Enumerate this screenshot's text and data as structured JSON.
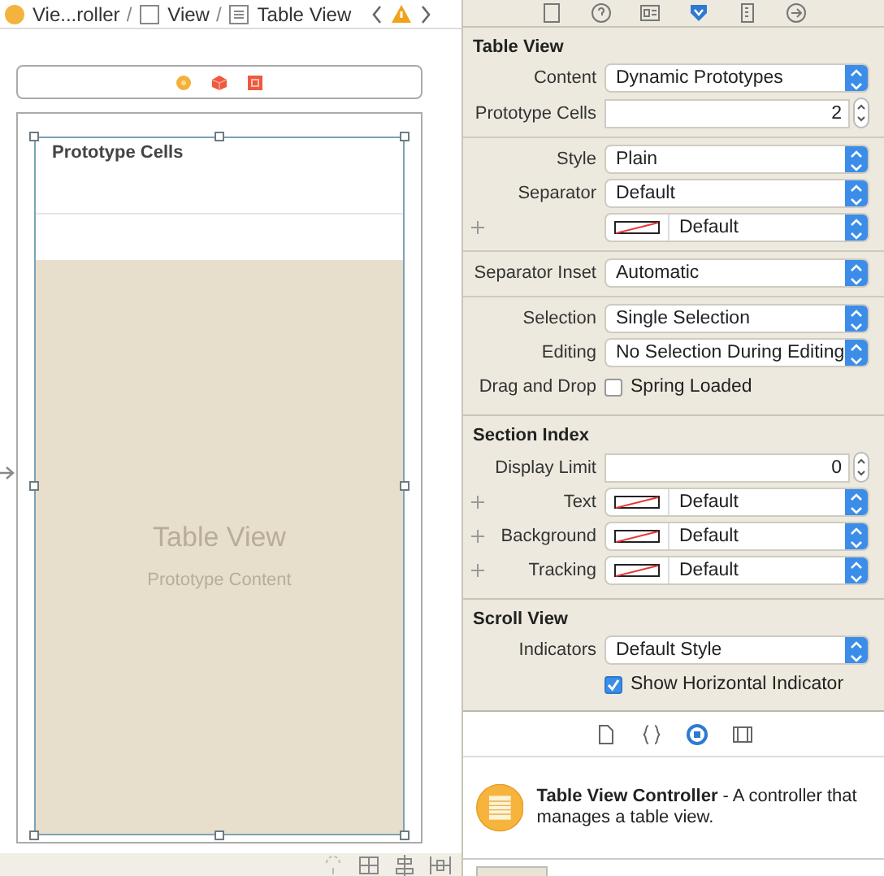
{
  "breadcrumb": {
    "items": [
      {
        "kind": "controller",
        "label": "Vie...roller"
      },
      {
        "kind": "view",
        "label": "View"
      },
      {
        "kind": "table",
        "label": "Table View"
      }
    ],
    "separator": "/"
  },
  "canvas": {
    "scene_dock": [
      {
        "kind": "controller"
      },
      {
        "kind": "responder"
      },
      {
        "kind": "exit"
      }
    ],
    "table": {
      "header": "Prototype Cells",
      "title": "Table View",
      "subtitle": "Prototype Content"
    },
    "toolbar": [
      {
        "kind": "update"
      },
      {
        "kind": "stack"
      },
      {
        "kind": "align"
      },
      {
        "kind": "pin"
      }
    ]
  },
  "inspector": {
    "tabs": [
      {
        "kind": "file",
        "selected": false
      },
      {
        "kind": "help",
        "selected": false
      },
      {
        "kind": "identity",
        "selected": false
      },
      {
        "kind": "attributes",
        "selected": true
      },
      {
        "kind": "size",
        "selected": false
      },
      {
        "kind": "connections",
        "selected": false
      }
    ],
    "sections": [
      {
        "title": "Table View",
        "rows": [
          {
            "kind": "popup",
            "label": "Content",
            "value": "Dynamic Prototypes"
          },
          {
            "kind": "stepper",
            "label": "Prototype Cells",
            "value": "2"
          },
          {
            "kind": "divider"
          },
          {
            "kind": "popup",
            "label": "Style",
            "value": "Plain"
          },
          {
            "kind": "popup",
            "label": "Separator",
            "value": "Default"
          },
          {
            "kind": "color",
            "plus": true,
            "value": "Default"
          },
          {
            "kind": "divider"
          },
          {
            "kind": "popup",
            "label": "Separator Inset",
            "value": "Automatic"
          },
          {
            "kind": "divider"
          },
          {
            "kind": "popup",
            "label": "Selection",
            "value": "Single Selection"
          },
          {
            "kind": "popup",
            "label": "Editing",
            "value": "No Selection During Editing"
          },
          {
            "kind": "checkbox",
            "label": "Drag and Drop",
            "value": "Spring Loaded",
            "checked": false
          }
        ]
      },
      {
        "title": "Section Index",
        "rows": [
          {
            "kind": "stepper",
            "label": "Display Limit",
            "value": "0"
          },
          {
            "kind": "color",
            "plus": true,
            "label": "Text",
            "value": "Default"
          },
          {
            "kind": "color",
            "plus": true,
            "label": "Background",
            "value": "Default"
          },
          {
            "kind": "color",
            "plus": true,
            "label": "Tracking",
            "value": "Default"
          }
        ]
      },
      {
        "title": "Scroll View",
        "rows": [
          {
            "kind": "popup",
            "label": "Indicators",
            "value": "Default Style"
          },
          {
            "kind": "checkbox",
            "value": "Show Horizontal Indicator",
            "checked": true
          }
        ]
      }
    ]
  },
  "library": {
    "tabs": [
      {
        "kind": "file",
        "selected": false
      },
      {
        "kind": "braces",
        "selected": false
      },
      {
        "kind": "object",
        "selected": true
      },
      {
        "kind": "media",
        "selected": false
      }
    ],
    "items": [
      {
        "kind": "table-controller",
        "description": "**Table View Controller** - A controller that manages a table view."
      },
      {
        "kind": "placeholder"
      }
    ]
  }
}
